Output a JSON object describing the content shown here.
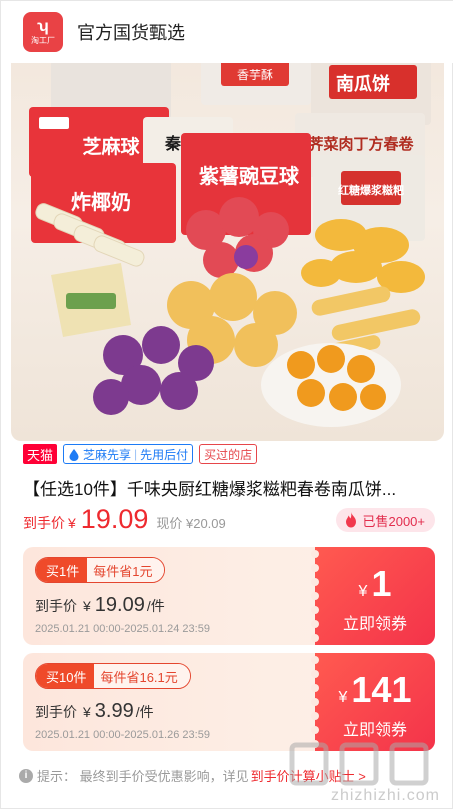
{
  "header": {
    "logo_line1": "淘工厂",
    "shop_name": "官方国货甄选"
  },
  "hero": {
    "package_labels": [
      "芝麻球",
      "炸椰奶",
      "紫薯豌豆球",
      "秦三鲜",
      "荠菜肉丁方春卷",
      "红糖爆浆糍粑",
      "南瓜饼",
      "香芋酥"
    ]
  },
  "tags": {
    "tmall": "天猫",
    "zhima": "芝麻先享",
    "zhima_sep": "|",
    "zhima_after": "先用后付",
    "bought": "买过的店"
  },
  "product": {
    "title": "【任选10件】千味央厨红糖爆浆糍粑春卷南瓜饼...",
    "price_label": "到手价",
    "price_yen": "¥",
    "price_value": "19.09",
    "current_price": "现价 ¥20.09",
    "sold": "已售2000+"
  },
  "coupons": [
    {
      "buy_qty": "买1件",
      "save": "每件省1元",
      "price_label": "到手价",
      "yen": "¥",
      "price": "19.09",
      "unit": "/件",
      "date": "2025.01.21 00:00-2025.01.24 23:59",
      "amount_yen": "¥",
      "amount": "1",
      "claim": "立即领券"
    },
    {
      "buy_qty": "买10件",
      "save": "每件省16.1元",
      "price_label": "到手价",
      "yen": "¥",
      "price": "3.99",
      "unit": "/件",
      "date": "2025.01.21 00:00-2025.01.26 23:59",
      "amount_yen": "¥",
      "amount": "141",
      "claim": "立即领券"
    }
  ],
  "tip": {
    "icon": "i",
    "text": "提示：  最终到手价受优惠影响，详见",
    "link": "到手价计算小贴士 >"
  },
  "watermark": {
    "text": "zhizhizhi.com"
  },
  "colors": {
    "accent_red": "#ee2a2f",
    "coupon_gradient": "#f4334a",
    "tmall_red": "#ff0036",
    "zhima_blue": "#1d7bf5"
  }
}
